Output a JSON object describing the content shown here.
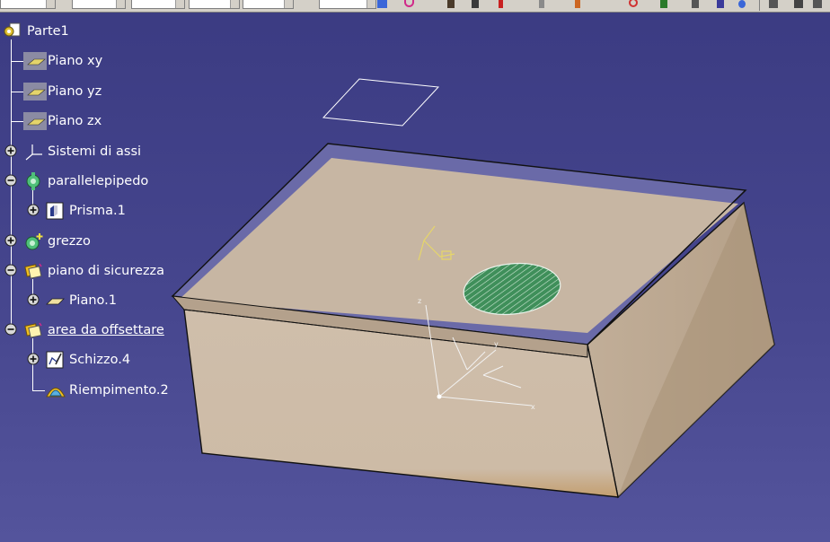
{
  "tree": {
    "root": {
      "label": "Parte1",
      "icon": "part-icon"
    },
    "items": [
      {
        "label": "Piano xy",
        "icon": "plane-icon"
      },
      {
        "label": "Piano yz",
        "icon": "plane-icon"
      },
      {
        "label": "Piano zx",
        "icon": "plane-icon"
      },
      {
        "label": "Sistemi di assi",
        "icon": "axis-system-icon"
      },
      {
        "label": "parallelepipedo",
        "icon": "body-icon"
      },
      {
        "label": "Prisma.1",
        "icon": "pad-icon"
      },
      {
        "label": "grezzo",
        "icon": "body-icon"
      },
      {
        "label": "piano di sicurezza",
        "icon": "geometrical-set-icon"
      },
      {
        "label": "Piano.1",
        "icon": "plane-feature-icon"
      },
      {
        "label": "area da offsettare",
        "icon": "geometrical-set-icon"
      },
      {
        "label": "Schizzo.4",
        "icon": "sketch-icon"
      },
      {
        "label": "Riempimento.2",
        "icon": "fill-surface-icon"
      }
    ]
  },
  "axis_labels": {
    "x": "x",
    "y": "y",
    "z": "z"
  },
  "colors": {
    "background_top": "#3b3b82",
    "background_bottom": "#54549c",
    "solid_face": "#c9b8a6",
    "fill_surface": "#3f8f5a",
    "tree_text": "#ffffff"
  }
}
